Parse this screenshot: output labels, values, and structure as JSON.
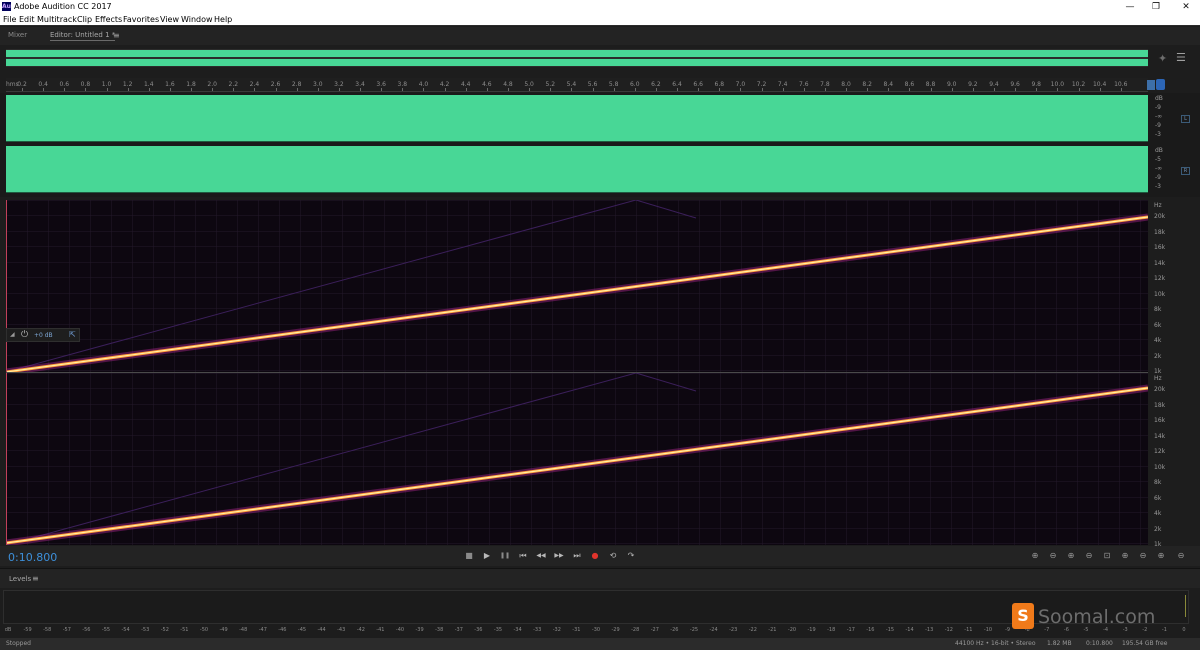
{
  "window": {
    "title": "Adobe Audition CC 2017",
    "icon_text": "Au",
    "minimize": "—",
    "maximize": "❐",
    "close": "✕"
  },
  "menu": [
    "File",
    "Edit",
    "Multitrack",
    "Clip",
    "Effects",
    "Favorites",
    "View",
    "Window",
    "Help"
  ],
  "tabs": {
    "mixer": "Mixer",
    "editor": "Editor: Untitled 1 *",
    "menu_icon": "≡"
  },
  "ruler": {
    "unit": "hms",
    "ticks": [
      "0.2",
      "0.4",
      "0.6",
      "0.8",
      "1.0",
      "1.2",
      "1.4",
      "1.6",
      "1.8",
      "2.0",
      "2.2",
      "2.4",
      "2.6",
      "2.8",
      "3.0",
      "3.2",
      "3.4",
      "3.6",
      "3.8",
      "4.0",
      "4.2",
      "4.4",
      "4.6",
      "4.8",
      "5.0",
      "5.2",
      "5.4",
      "5.6",
      "5.8",
      "6.0",
      "6.2",
      "6.4",
      "6.6",
      "6.8",
      "7.0",
      "7.2",
      "7.4",
      "7.6",
      "7.8",
      "8.0",
      "8.2",
      "8.4",
      "8.6",
      "8.8",
      "9.0",
      "9.2",
      "9.4",
      "9.6",
      "9.8",
      "10.0",
      "10.2",
      "10.4",
      "10.6"
    ]
  },
  "waveform": {
    "color": "#48d796",
    "db_labels_l": [
      "dB",
      "-9",
      "-∞",
      "-9",
      "-3"
    ],
    "db_labels_r": [
      "dB",
      "-5",
      "-∞",
      "-9",
      "-3"
    ],
    "channel_l": "L",
    "channel_r": "R"
  },
  "spectral": {
    "hz_label": "Hz",
    "freq_labels": [
      "20k",
      "18k",
      "16k",
      "14k",
      "12k",
      "10k",
      "8k",
      "6k",
      "4k",
      "2k",
      "1k"
    ],
    "hud_db": "+0 dB"
  },
  "transport": {
    "timecode": "0:10.800",
    "buttons": {
      "stop": "■",
      "play": "▶",
      "pause": "❚❚",
      "to_start": "⏮",
      "rewind": "◀◀",
      "forward": "▶▶",
      "to_end": "⏭",
      "record": "●",
      "loop": "⟲",
      "skip": "↷"
    }
  },
  "levels": {
    "title": "Levels",
    "menu_icon": "≡",
    "scale": [
      "dB",
      "-59",
      "-58",
      "-57",
      "-56",
      "-55",
      "-54",
      "-53",
      "-52",
      "-51",
      "-50",
      "-49",
      "-48",
      "-47",
      "-46",
      "-45",
      "-44",
      "-43",
      "-42",
      "-41",
      "-40",
      "-39",
      "-38",
      "-37",
      "-36",
      "-35",
      "-34",
      "-33",
      "-32",
      "-31",
      "-30",
      "-29",
      "-28",
      "-27",
      "-26",
      "-25",
      "-24",
      "-23",
      "-22",
      "-21",
      "-20",
      "-19",
      "-18",
      "-17",
      "-16",
      "-15",
      "-14",
      "-13",
      "-12",
      "-11",
      "-10",
      "-9",
      "-8",
      "-7",
      "-6",
      "-5",
      "-4",
      "-3",
      "-2",
      "-1",
      "0"
    ]
  },
  "status": {
    "state": "Stopped",
    "sample_info": "44100 Hz • 16-bit • Stereo",
    "file_size": "1.82 MB",
    "duration": "0:10.800",
    "free_space": "195.54 GB free"
  },
  "watermark": {
    "text": "Soomal.com",
    "logo": "S"
  }
}
